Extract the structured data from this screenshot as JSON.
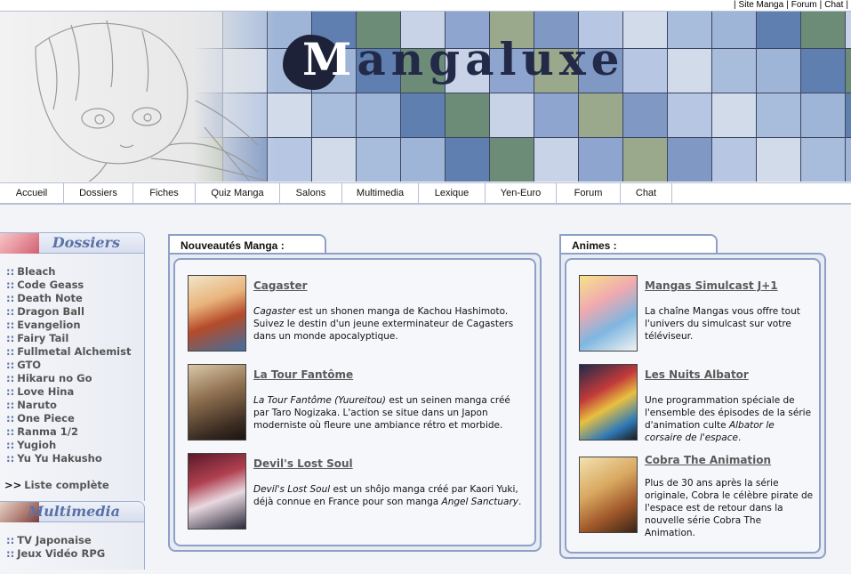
{
  "toplinks": [
    "Site Manga",
    "Forum",
    "Chat"
  ],
  "logo": {
    "first": "M",
    "rest": "angaluxe"
  },
  "nav": [
    "Accueil",
    "Dossiers",
    "Fiches",
    "Quiz Manga",
    "Salons",
    "Multimedia",
    "Lexique",
    "Yen-Euro",
    "Forum",
    "Chat"
  ],
  "sidebar": {
    "dossiers_title": "Dossiers",
    "dossiers": [
      "Bleach",
      "Code Geass",
      "Death Note",
      "Dragon Ball",
      "Evangelion",
      "Fairy Tail",
      "Fullmetal Alchemist",
      "GTO",
      "Hikaru no Go",
      "Love Hina",
      "Naruto",
      "One Piece",
      "Ranma 1/2",
      "Yugioh",
      "Yu Yu Hakusho"
    ],
    "marker": "::",
    "more_marker": ">>",
    "more_label": "Liste complète",
    "multimedia_title": "Multimedia",
    "multimedia": [
      "TV Japonaise",
      "Jeux Vidéo RPG"
    ]
  },
  "manga_panel": {
    "title": "Nouveautés Manga :",
    "entries": [
      {
        "title": "Cagaster",
        "desc_em": "Cagaster",
        "desc": " est un shonen manga de Kachou Hashimoto. Suivez le destin d'un jeune exterminateur de Cagasters dans un monde apocalyptique."
      },
      {
        "title": "La Tour Fantôme",
        "desc_em": "La Tour Fantôme (Yuureitou)",
        "desc": " est un seinen manga créé par Taro Nogizaka. L'action se situe dans un Japon moderniste où fleure une ambiance rétro et morbide."
      },
      {
        "title": "Devil's Lost Soul",
        "desc_em": "Devil's Lost Soul",
        "desc": " est un shôjo manga créé par Kaori Yuki, déjà connue en France pour son manga ",
        "desc_em2": "Angel Sanctuary",
        "desc_end": "."
      }
    ]
  },
  "anime_panel": {
    "title": "Animes :",
    "entries": [
      {
        "title": "Mangas Simulcast J+1",
        "desc": "La chaîne Mangas vous offre tout l'univers du simulcast sur votre téléviseur."
      },
      {
        "title": "Les Nuits Albator",
        "desc": "Une programmation spéciale de l'ensemble des épisodes de la série d'animation culte ",
        "desc_em": "Albator le corsaire de l'espace",
        "desc_end": "."
      },
      {
        "title": "Cobra The Animation",
        "desc": "Plus de 30 ans après la série originale, Cobra le célèbre pirate de l'espace est de retour dans la nouvelle série Cobra The Animation."
      }
    ]
  }
}
